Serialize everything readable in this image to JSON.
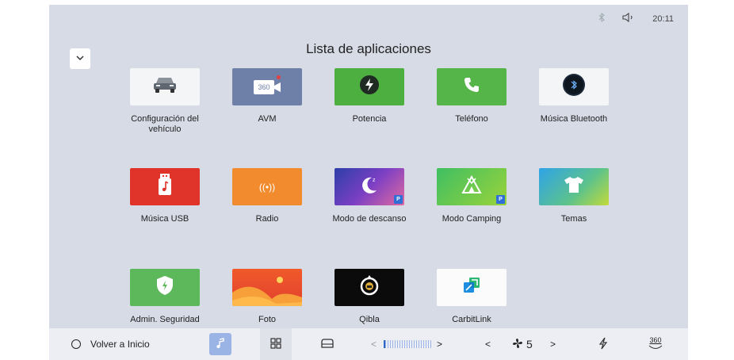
{
  "status_bar": {
    "bluetooth_icon": "bluetooth-icon",
    "volume_icon": "volume-icon",
    "time": "20:11"
  },
  "title": "Lista de aplicaciones",
  "apps": {
    "vehicle_settings": {
      "label": "Configuración del vehículo",
      "icon": "car-icon"
    },
    "avm": {
      "label": "AVM",
      "icon": "camera-360-icon",
      "icon_text": "360"
    },
    "power": {
      "label": "Potencia",
      "icon": "lightning-icon"
    },
    "phone": {
      "label": "Teléfono",
      "icon": "phone-icon"
    },
    "bt_music": {
      "label": "Música Bluetooth",
      "icon": "bluetooth-icon"
    },
    "usb_music": {
      "label": "Música USB",
      "icon": "usb-music-icon"
    },
    "radio": {
      "label": "Radio",
      "icon": "radio-icon",
      "icon_text": "((•))"
    },
    "rest_mode": {
      "label": "Modo de descanso",
      "icon": "moon-icon",
      "badge": "P"
    },
    "camping_mode": {
      "label": "Modo Camping",
      "icon": "tent-icon",
      "badge": "P"
    },
    "themes": {
      "label": "Temas",
      "icon": "tshirt-icon"
    },
    "security": {
      "label": "Admin. Seguridad",
      "icon": "shield-icon"
    },
    "photo": {
      "label": "Foto",
      "icon": "photo-icon"
    },
    "qibla": {
      "label": "Qibla",
      "icon": "compass-icon"
    },
    "carbitlink": {
      "label": "CarbitLink",
      "icon": "carbitlink-icon"
    }
  },
  "dock": {
    "home_label": "Volver a Inicio",
    "fan_speed": "5",
    "prev_glyph": "<",
    "next_glyph": ">",
    "avm_text": "360"
  },
  "colors": {
    "screen_bg": "#d7dbe6",
    "vehicle": "#f4f5f7",
    "avm": "#6e7fa8",
    "power": "#4caf3f",
    "phone": "#56b548",
    "bt": "#f4f5f7",
    "usb": "#e0342b",
    "radio": "#f28a2e",
    "themes_start": "#2fa3e8",
    "security": "#5cb85a",
    "photo": "#ea4d2d",
    "qibla": "#0b0b0b",
    "carbitlink": "#fbfbfb"
  }
}
